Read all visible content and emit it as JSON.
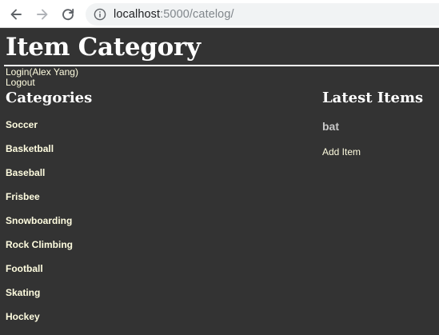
{
  "browser": {
    "url_host": "localhost",
    "url_path": ":5000/catelog/"
  },
  "header": {
    "title": "Item Category",
    "login_text": "Login(Alex Yang)",
    "logout_text": "Logout"
  },
  "categories": {
    "heading": "Categories",
    "items": [
      "Soccer",
      "Basketball",
      "Baseball",
      "Frisbee",
      "Snowboarding",
      "Rock Climbing",
      "Football",
      "Skating",
      "Hockey"
    ]
  },
  "latest": {
    "heading": "Latest Items",
    "items": [
      "bat"
    ],
    "add_item_label": "Add Item"
  },
  "colors": {
    "page_bg": "#333333",
    "link": "#fffde0",
    "heading": "#ffffff",
    "latest_item": "#c8c8c8"
  }
}
